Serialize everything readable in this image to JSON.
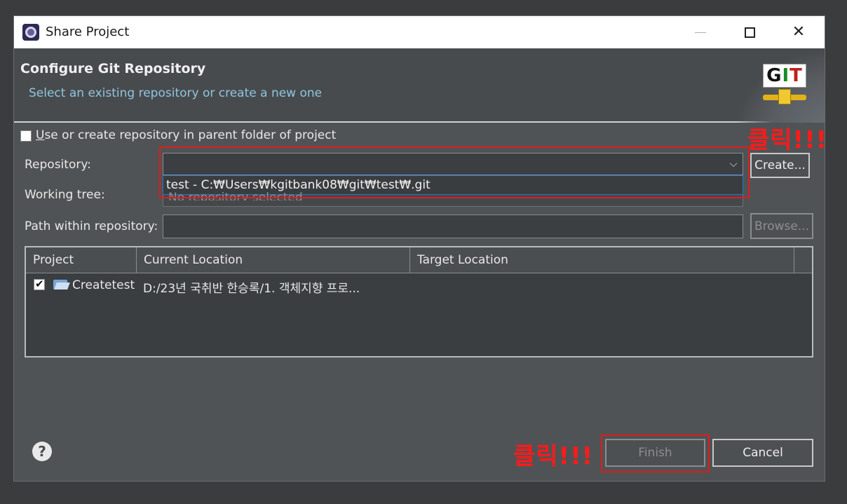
{
  "window": {
    "title": "Share Project"
  },
  "header": {
    "title": "Configure Git Repository",
    "subtitle": "Select an existing repository or create a new one",
    "logo_text": "GIT"
  },
  "options": {
    "use_parent_label": "Use or create repository in parent folder of project",
    "use_parent_checked": false
  },
  "form": {
    "repository_label": "Repository:",
    "repository_value": "",
    "repository_dropdown_option": "test - C:₩Users₩kgitbank08₩git₩test₩.git",
    "create_button": "Create...",
    "working_tree_label": "Working tree:",
    "working_tree_placeholder": "No repository selected",
    "path_label": "Path within repository:",
    "path_value": "",
    "browse_button": "Browse..."
  },
  "table": {
    "columns": [
      "Project",
      "Current Location",
      "Target Location"
    ],
    "rows": [
      {
        "checked": true,
        "project": "Createtest",
        "current_location": "D:/23년 국취반 한승록/1. 객체지향 프로...",
        "target_location": ""
      }
    ]
  },
  "footer": {
    "finish_button": "Finish",
    "cancel_button": "Cancel"
  },
  "annotations": {
    "click_text_1": "클릭!!!",
    "click_text_2": "클릭!!!",
    "color": "#e01b1b"
  },
  "colors": {
    "dialog_bg": "#505355",
    "subtitle": "#8fc5de",
    "selection_border": "#1d7ad0"
  }
}
